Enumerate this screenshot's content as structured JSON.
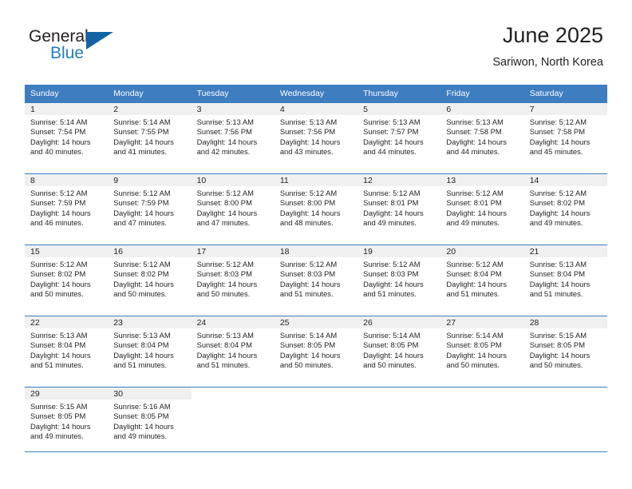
{
  "brand": {
    "name_part1": "General",
    "name_part2": "Blue",
    "accent_color": "#1f7fc4",
    "triangle_color": "#1464a5"
  },
  "header": {
    "title": "June 2025",
    "subtitle": "Sariwon, North Korea"
  },
  "calendar": {
    "header_bg": "#3d7dc0",
    "daynum_bg": "#f0f0f0",
    "weekday_headers": [
      "Sunday",
      "Monday",
      "Tuesday",
      "Wednesday",
      "Thursday",
      "Friday",
      "Saturday"
    ],
    "weeks": [
      [
        {
          "day": "1",
          "sunrise": "Sunrise: 5:14 AM",
          "sunset": "Sunset: 7:54 PM",
          "daylight1": "Daylight: 14 hours",
          "daylight2": "and 40 minutes."
        },
        {
          "day": "2",
          "sunrise": "Sunrise: 5:14 AM",
          "sunset": "Sunset: 7:55 PM",
          "daylight1": "Daylight: 14 hours",
          "daylight2": "and 41 minutes."
        },
        {
          "day": "3",
          "sunrise": "Sunrise: 5:13 AM",
          "sunset": "Sunset: 7:56 PM",
          "daylight1": "Daylight: 14 hours",
          "daylight2": "and 42 minutes."
        },
        {
          "day": "4",
          "sunrise": "Sunrise: 5:13 AM",
          "sunset": "Sunset: 7:56 PM",
          "daylight1": "Daylight: 14 hours",
          "daylight2": "and 43 minutes."
        },
        {
          "day": "5",
          "sunrise": "Sunrise: 5:13 AM",
          "sunset": "Sunset: 7:57 PM",
          "daylight1": "Daylight: 14 hours",
          "daylight2": "and 44 minutes."
        },
        {
          "day": "6",
          "sunrise": "Sunrise: 5:13 AM",
          "sunset": "Sunset: 7:58 PM",
          "daylight1": "Daylight: 14 hours",
          "daylight2": "and 44 minutes."
        },
        {
          "day": "7",
          "sunrise": "Sunrise: 5:12 AM",
          "sunset": "Sunset: 7:58 PM",
          "daylight1": "Daylight: 14 hours",
          "daylight2": "and 45 minutes."
        }
      ],
      [
        {
          "day": "8",
          "sunrise": "Sunrise: 5:12 AM",
          "sunset": "Sunset: 7:59 PM",
          "daylight1": "Daylight: 14 hours",
          "daylight2": "and 46 minutes."
        },
        {
          "day": "9",
          "sunrise": "Sunrise: 5:12 AM",
          "sunset": "Sunset: 7:59 PM",
          "daylight1": "Daylight: 14 hours",
          "daylight2": "and 47 minutes."
        },
        {
          "day": "10",
          "sunrise": "Sunrise: 5:12 AM",
          "sunset": "Sunset: 8:00 PM",
          "daylight1": "Daylight: 14 hours",
          "daylight2": "and 47 minutes."
        },
        {
          "day": "11",
          "sunrise": "Sunrise: 5:12 AM",
          "sunset": "Sunset: 8:00 PM",
          "daylight1": "Daylight: 14 hours",
          "daylight2": "and 48 minutes."
        },
        {
          "day": "12",
          "sunrise": "Sunrise: 5:12 AM",
          "sunset": "Sunset: 8:01 PM",
          "daylight1": "Daylight: 14 hours",
          "daylight2": "and 49 minutes."
        },
        {
          "day": "13",
          "sunrise": "Sunrise: 5:12 AM",
          "sunset": "Sunset: 8:01 PM",
          "daylight1": "Daylight: 14 hours",
          "daylight2": "and 49 minutes."
        },
        {
          "day": "14",
          "sunrise": "Sunrise: 5:12 AM",
          "sunset": "Sunset: 8:02 PM",
          "daylight1": "Daylight: 14 hours",
          "daylight2": "and 49 minutes."
        }
      ],
      [
        {
          "day": "15",
          "sunrise": "Sunrise: 5:12 AM",
          "sunset": "Sunset: 8:02 PM",
          "daylight1": "Daylight: 14 hours",
          "daylight2": "and 50 minutes."
        },
        {
          "day": "16",
          "sunrise": "Sunrise: 5:12 AM",
          "sunset": "Sunset: 8:02 PM",
          "daylight1": "Daylight: 14 hours",
          "daylight2": "and 50 minutes."
        },
        {
          "day": "17",
          "sunrise": "Sunrise: 5:12 AM",
          "sunset": "Sunset: 8:03 PM",
          "daylight1": "Daylight: 14 hours",
          "daylight2": "and 50 minutes."
        },
        {
          "day": "18",
          "sunrise": "Sunrise: 5:12 AM",
          "sunset": "Sunset: 8:03 PM",
          "daylight1": "Daylight: 14 hours",
          "daylight2": "and 51 minutes."
        },
        {
          "day": "19",
          "sunrise": "Sunrise: 5:12 AM",
          "sunset": "Sunset: 8:03 PM",
          "daylight1": "Daylight: 14 hours",
          "daylight2": "and 51 minutes."
        },
        {
          "day": "20",
          "sunrise": "Sunrise: 5:12 AM",
          "sunset": "Sunset: 8:04 PM",
          "daylight1": "Daylight: 14 hours",
          "daylight2": "and 51 minutes."
        },
        {
          "day": "21",
          "sunrise": "Sunrise: 5:13 AM",
          "sunset": "Sunset: 8:04 PM",
          "daylight1": "Daylight: 14 hours",
          "daylight2": "and 51 minutes."
        }
      ],
      [
        {
          "day": "22",
          "sunrise": "Sunrise: 5:13 AM",
          "sunset": "Sunset: 8:04 PM",
          "daylight1": "Daylight: 14 hours",
          "daylight2": "and 51 minutes."
        },
        {
          "day": "23",
          "sunrise": "Sunrise: 5:13 AM",
          "sunset": "Sunset: 8:04 PM",
          "daylight1": "Daylight: 14 hours",
          "daylight2": "and 51 minutes."
        },
        {
          "day": "24",
          "sunrise": "Sunrise: 5:13 AM",
          "sunset": "Sunset: 8:04 PM",
          "daylight1": "Daylight: 14 hours",
          "daylight2": "and 51 minutes."
        },
        {
          "day": "25",
          "sunrise": "Sunrise: 5:14 AM",
          "sunset": "Sunset: 8:05 PM",
          "daylight1": "Daylight: 14 hours",
          "daylight2": "and 50 minutes."
        },
        {
          "day": "26",
          "sunrise": "Sunrise: 5:14 AM",
          "sunset": "Sunset: 8:05 PM",
          "daylight1": "Daylight: 14 hours",
          "daylight2": "and 50 minutes."
        },
        {
          "day": "27",
          "sunrise": "Sunrise: 5:14 AM",
          "sunset": "Sunset: 8:05 PM",
          "daylight1": "Daylight: 14 hours",
          "daylight2": "and 50 minutes."
        },
        {
          "day": "28",
          "sunrise": "Sunrise: 5:15 AM",
          "sunset": "Sunset: 8:05 PM",
          "daylight1": "Daylight: 14 hours",
          "daylight2": "and 50 minutes."
        }
      ],
      [
        {
          "day": "29",
          "sunrise": "Sunrise: 5:15 AM",
          "sunset": "Sunset: 8:05 PM",
          "daylight1": "Daylight: 14 hours",
          "daylight2": "and 49 minutes."
        },
        {
          "day": "30",
          "sunrise": "Sunrise: 5:16 AM",
          "sunset": "Sunset: 8:05 PM",
          "daylight1": "Daylight: 14 hours",
          "daylight2": "and 49 minutes."
        },
        {
          "day": "",
          "sunrise": "",
          "sunset": "",
          "daylight1": "",
          "daylight2": ""
        },
        {
          "day": "",
          "sunrise": "",
          "sunset": "",
          "daylight1": "",
          "daylight2": ""
        },
        {
          "day": "",
          "sunrise": "",
          "sunset": "",
          "daylight1": "",
          "daylight2": ""
        },
        {
          "day": "",
          "sunrise": "",
          "sunset": "",
          "daylight1": "",
          "daylight2": ""
        },
        {
          "day": "",
          "sunrise": "",
          "sunset": "",
          "daylight1": "",
          "daylight2": ""
        }
      ]
    ]
  }
}
